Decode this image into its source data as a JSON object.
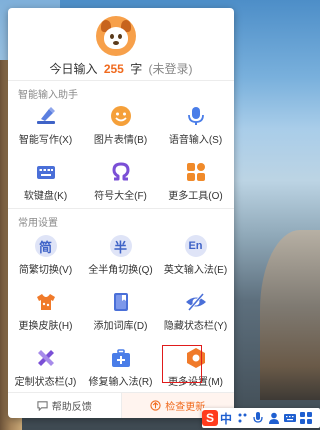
{
  "header": {
    "stats_prefix": "今日输入",
    "count": "255",
    "unit": "字",
    "login_status": "(未登录)"
  },
  "section1": {
    "title": "智能输入助手",
    "items": [
      {
        "label": "智能写作(X)",
        "icon": "smart-write-icon"
      },
      {
        "label": "图片表情(B)",
        "icon": "smiley-icon"
      },
      {
        "label": "语音输入(S)",
        "icon": "microphone-icon"
      },
      {
        "label": "软键盘(K)",
        "icon": "keyboard-icon"
      },
      {
        "label": "符号大全(F)",
        "icon": "omega-icon"
      },
      {
        "label": "更多工具(O)",
        "icon": "grid-icon"
      }
    ]
  },
  "section2": {
    "title": "常用设置",
    "items": [
      {
        "label": "简繁切换(V)",
        "glyph": "简"
      },
      {
        "label": "全半角切换(Q)",
        "glyph": "半"
      },
      {
        "label": "英文输入法(E)",
        "glyph": "En"
      },
      {
        "label": "更换皮肤(H)",
        "icon": "shirt-icon"
      },
      {
        "label": "添加词库(D)",
        "icon": "book-icon"
      },
      {
        "label": "隐藏状态栏(Y)",
        "icon": "eye-hidden-icon"
      },
      {
        "label": "定制状态栏(J)",
        "icon": "ruler-pencil-icon"
      },
      {
        "label": "修复输入法(R)",
        "icon": "toolbox-icon"
      },
      {
        "label": "更多设置(M)",
        "icon": "settings-hexagon-icon"
      }
    ]
  },
  "footer": {
    "feedback": "帮助反馈",
    "update": "检查更新"
  },
  "ime_bar": {
    "mode": "中"
  },
  "colors": {
    "accent_blue": "#3f63c7",
    "orange": "#f06a1e",
    "highlight_red": "#e01b1b"
  }
}
